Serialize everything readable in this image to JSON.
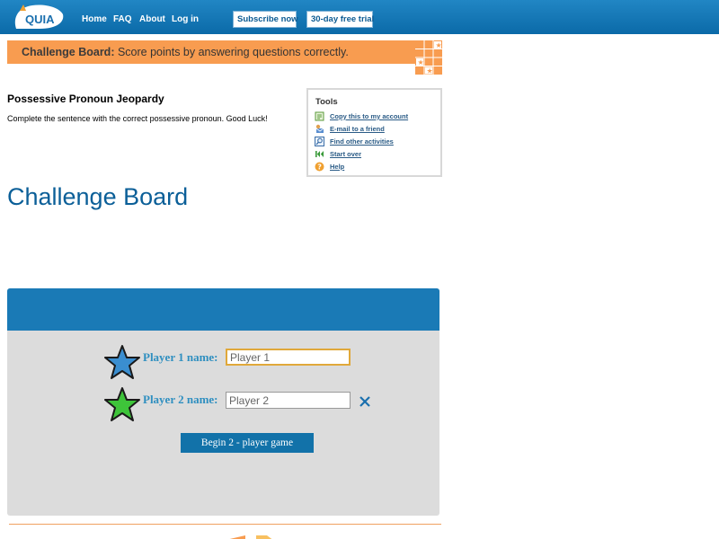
{
  "nav": {
    "logo_text": "QUIA",
    "links": [
      "Home",
      "FAQ",
      "About",
      "Log in"
    ],
    "subscribe_label": "Subscribe now",
    "trial_label": "30-day free trial"
  },
  "banner": {
    "bold": "Challenge Board:",
    "text": " Score points by answering questions correctly."
  },
  "activity": {
    "title": "Possessive Pronoun Jeopardy",
    "description": "Complete the sentence with the correct possessive pronoun. Good Luck!"
  },
  "tools": {
    "title": "Tools",
    "items": [
      {
        "label": "Copy this to my account",
        "icon": "copy-icon"
      },
      {
        "label": "E-mail to a friend",
        "icon": "email-icon"
      },
      {
        "label": "Find other activities",
        "icon": "find-icon"
      },
      {
        "label": "Start over",
        "icon": "start-over-icon"
      },
      {
        "label": "Help",
        "icon": "help-icon"
      }
    ]
  },
  "heading": "Challenge Board",
  "game": {
    "players": [
      {
        "label": "Player 1 name:",
        "value": "Player 1",
        "star_color": "#3a8ed0"
      },
      {
        "label": "Player 2 name:",
        "value": "Player 2",
        "star_color": "#3ec43a"
      }
    ],
    "begin_label": "Begin 2 - player game"
  },
  "colors": {
    "nav_blue": "#0b6aa8",
    "banner_orange": "#f89c50",
    "heading_blue": "#0b5f98",
    "panel_gray": "#dcdcdc"
  }
}
